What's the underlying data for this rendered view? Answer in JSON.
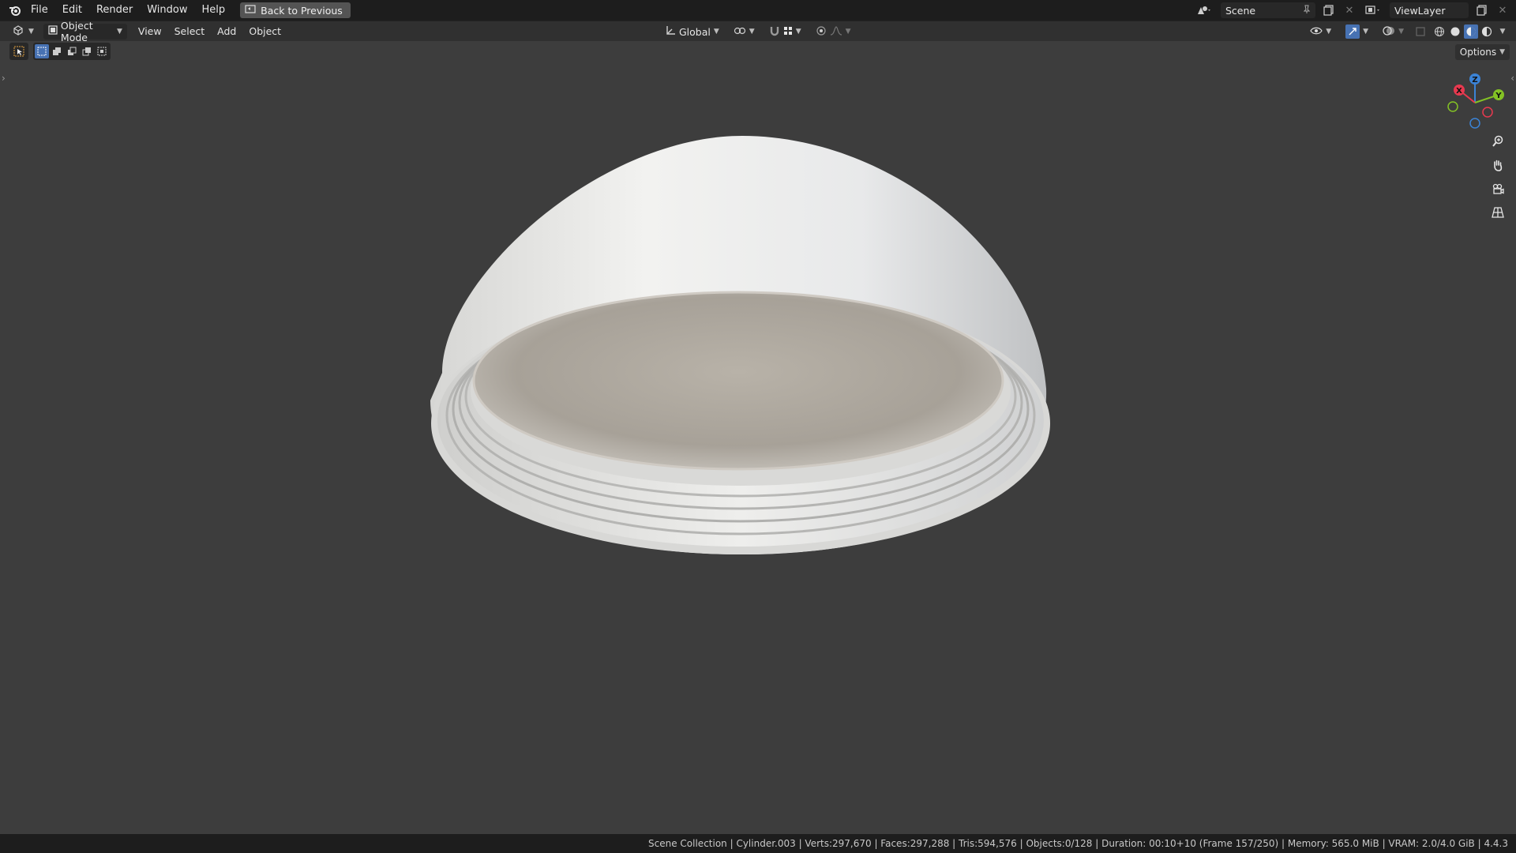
{
  "topbar": {
    "menus": [
      "File",
      "Edit",
      "Render",
      "Window",
      "Help"
    ],
    "back_button": "Back to Previous",
    "scene": "Scene",
    "view_layer": "ViewLayer"
  },
  "header": {
    "mode": "Object Mode",
    "menus": [
      "View",
      "Select",
      "Add",
      "Object"
    ],
    "orientation": "Global",
    "options": "Options"
  },
  "gizmo": {
    "x": "X",
    "y": "Y",
    "z": "Z"
  },
  "statusbar": {
    "text": "Scene Collection | Cylinder.003 | Verts:297,670 | Faces:297,288 | Tris:594,576 | Objects:0/128 | Duration: 00:10+10 (Frame 157/250) | Memory: 565.0 MiB | VRAM: 2.0/4.0 GiB | 4.4.3"
  },
  "colors": {
    "bg_viewport": "#3d3d3d",
    "topbar": "#1d1d1d",
    "header": "#303030",
    "axis_x": "#e8394f",
    "axis_y": "#84c225",
    "axis_z": "#3b83d6",
    "accent_blue": "#4772b3"
  }
}
